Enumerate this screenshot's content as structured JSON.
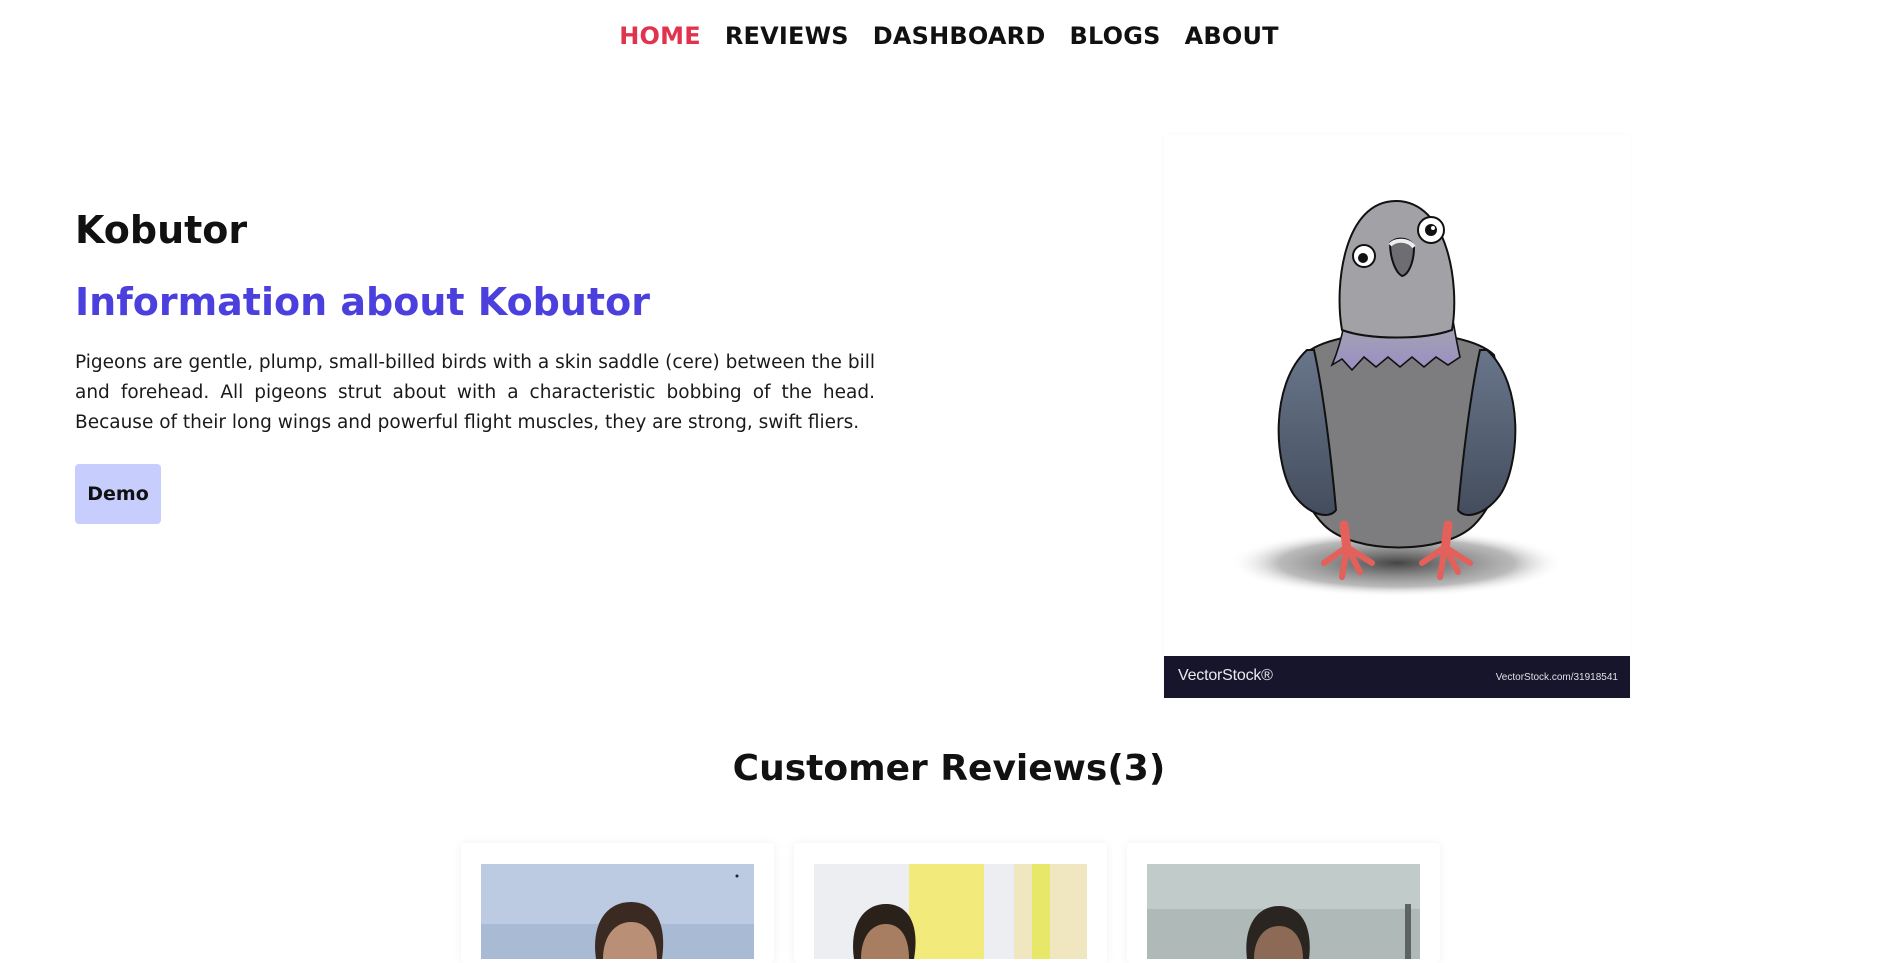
{
  "nav": {
    "items": [
      {
        "label": "HOME",
        "active": true
      },
      {
        "label": "REVIEWS",
        "active": false
      },
      {
        "label": "DASHBOARD",
        "active": false
      },
      {
        "label": "BLOGS",
        "active": false
      },
      {
        "label": "ABOUT",
        "active": false
      }
    ]
  },
  "hero": {
    "title": "Kobutor",
    "subtitle": "Information about Kobutor",
    "description": "Pigeons are gentle, plump, small-billed birds with a skin saddle (cere) between the bill and forehead. All pigeons strut about with a characteristic bobbing of the head. Because of their long wings and powerful flight muscles, they are strong, swift fliers.",
    "demo_label": "Demo",
    "image": {
      "subject": "cartoon pigeon illustration",
      "watermark_logo": "VectorStock®",
      "watermark_url": "VectorStock.com/31918541"
    }
  },
  "reviews": {
    "heading": "Customer Reviews(3)",
    "cards": [
      {
        "photo": "customer-photo-1"
      },
      {
        "photo": "customer-photo-2"
      },
      {
        "photo": "customer-photo-3"
      }
    ]
  },
  "colors": {
    "nav_active": "#e0344e",
    "subtitle": "#4b3fdd",
    "demo_button_bg": "#c7cdfc",
    "text": "#111111"
  }
}
